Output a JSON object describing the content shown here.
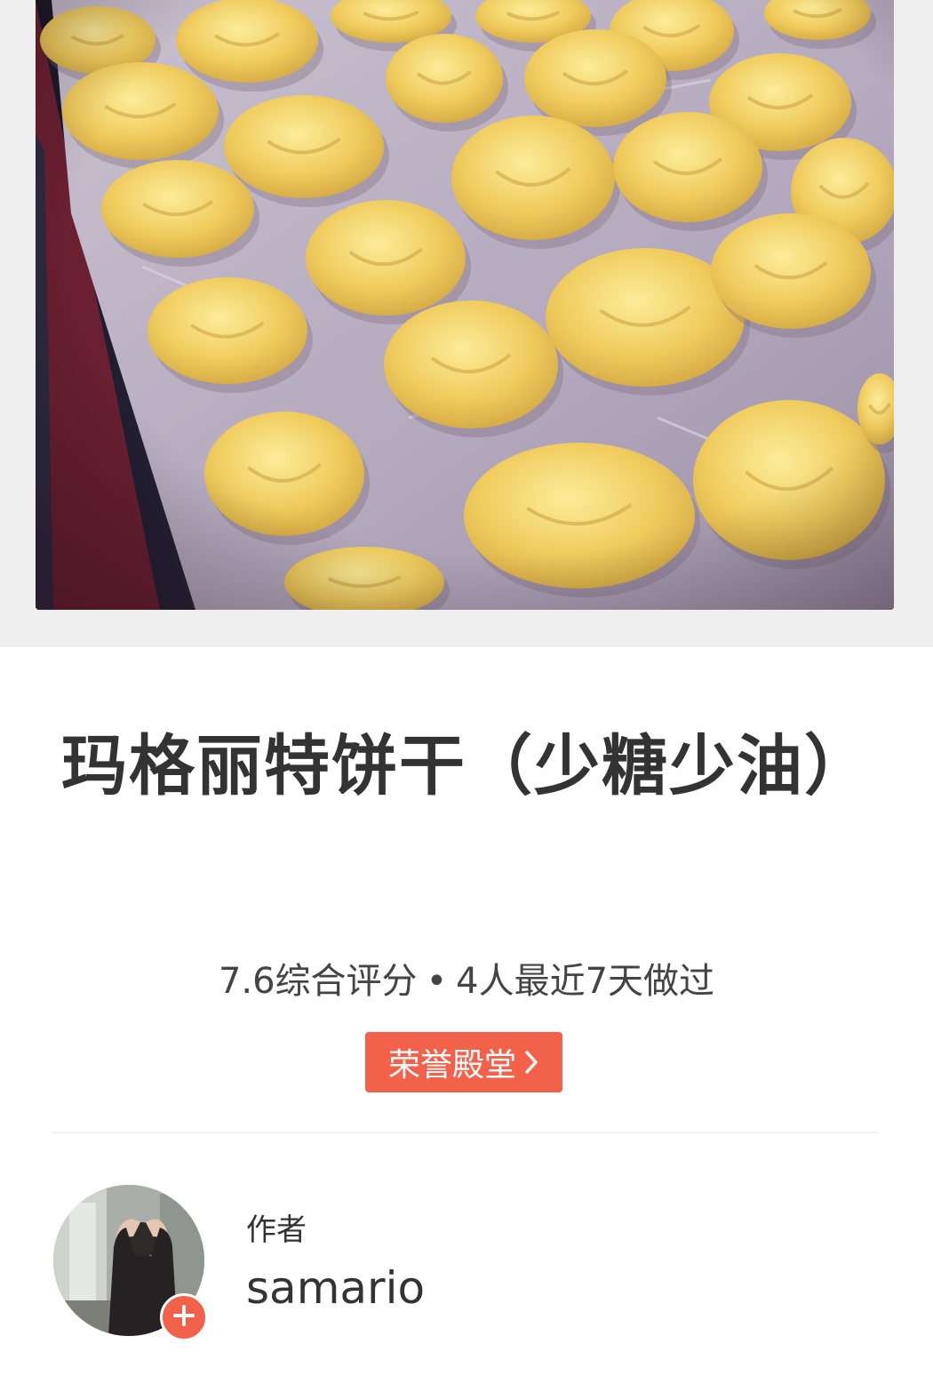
{
  "header_image": {
    "subject": "cookie dough balls on a baking tray",
    "palette": {
      "tray_paper": "#b8aec0",
      "dough": "#f0cc5e",
      "dough_highlight": "#fbe98f",
      "dough_shadow": "#c9a03c",
      "tray_rim": "#262238",
      "background": "#6a2031"
    }
  },
  "recipe": {
    "title": "玛格丽特饼干（少糖少油）",
    "rating": "7.6综合评分",
    "separator": "•",
    "made_recently": "4人最近7天做过",
    "badge_label": "荣誉殿堂",
    "badge_icon": "chevron-right-icon"
  },
  "author": {
    "caption": "作者",
    "name": "samario",
    "follow_icon": "plus-icon"
  },
  "colors": {
    "accent": "#f2624b",
    "text_primary": "#333333",
    "photo_border": "#efeeee",
    "divider": "#f1f1f1"
  }
}
